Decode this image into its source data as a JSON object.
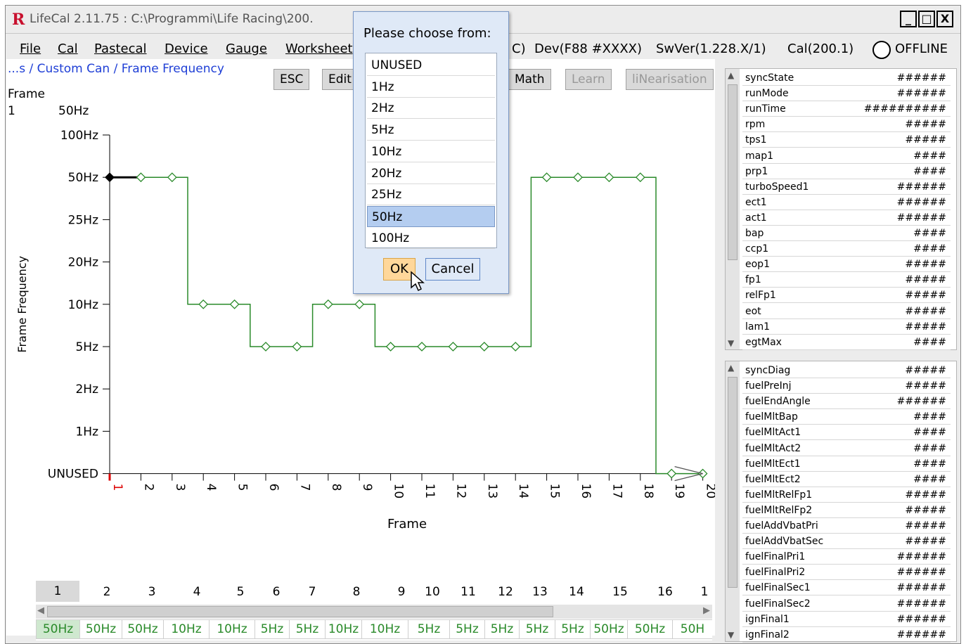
{
  "window": {
    "title": "LifeCal 2.11.75  :  C:\\Programmi\\Life Racing\\200.",
    "controls": [
      "_",
      "□",
      "X"
    ]
  },
  "menu": {
    "items": [
      "File",
      "Cal",
      "Pastecal",
      "Device",
      "Gauge",
      "Worksheet"
    ],
    "status": [
      "C)",
      "Dev(F88 #XXXX)",
      "SwVer(1.228.X/1)",
      "Cal(200.1)"
    ],
    "connection": "OFFLINE"
  },
  "editor": {
    "breadcrumb": "...s / Custom Can / Frame Frequency",
    "toolbar": {
      "esc": "ESC",
      "edit": "Edit",
      "math": "Math",
      "learn": "Learn",
      "linearisation": "liNearisation"
    },
    "cursor_name": "Frame",
    "cursor_index": "1",
    "cursor_value": "50Hz"
  },
  "chart_data": {
    "type": "line",
    "xlabel": "Frame",
    "ylabel": "Frame Frequency",
    "x": [
      1,
      2,
      3,
      4,
      5,
      6,
      7,
      8,
      9,
      10,
      11,
      12,
      13,
      14,
      15,
      16,
      17,
      18,
      19,
      20
    ],
    "y_levels": [
      "UNUSED",
      "1Hz",
      "2Hz",
      "5Hz",
      "10Hz",
      "20Hz",
      "25Hz",
      "50Hz",
      "100Hz"
    ],
    "values": [
      "50Hz",
      "50Hz",
      "50Hz",
      "10Hz",
      "10Hz",
      "5Hz",
      "5Hz",
      "10Hz",
      "10Hz",
      "5Hz",
      "5Hz",
      "5Hz",
      "5Hz",
      "5Hz",
      "50Hz",
      "50Hz",
      "50Hz",
      "50Hz",
      "UNUSED",
      "UNUSED"
    ],
    "selected_x": 1,
    "color": "#2a8a2a"
  },
  "grid": {
    "indices": [
      "1",
      "2",
      "3",
      "4",
      "5",
      "6",
      "7",
      "8",
      "9",
      "10",
      "11",
      "12",
      "13",
      "14",
      "15",
      "16",
      "1"
    ],
    "values": [
      "50Hz",
      "50Hz",
      "50Hz",
      "10Hz",
      "10Hz",
      "5Hz",
      "5Hz",
      "10Hz",
      "10Hz",
      "5Hz",
      "5Hz",
      "5Hz",
      "5Hz",
      "5Hz",
      "50Hz",
      "50Hz",
      "50H"
    ]
  },
  "gauges_top": [
    {
      "name": "syncState",
      "value": "######"
    },
    {
      "name": "runMode",
      "value": "######"
    },
    {
      "name": "runTime",
      "value": "##########"
    },
    {
      "name": "rpm",
      "value": "#####"
    },
    {
      "name": "tps1",
      "value": "#####"
    },
    {
      "name": "map1",
      "value": "####"
    },
    {
      "name": "prp1",
      "value": "####"
    },
    {
      "name": "turboSpeed1",
      "value": "######"
    },
    {
      "name": "ect1",
      "value": "######"
    },
    {
      "name": "act1",
      "value": "######"
    },
    {
      "name": "bap",
      "value": "####"
    },
    {
      "name": "ccp1",
      "value": "####"
    },
    {
      "name": "eop1",
      "value": "#####"
    },
    {
      "name": "fp1",
      "value": "#####"
    },
    {
      "name": "relFp1",
      "value": "#####"
    },
    {
      "name": "eot",
      "value": "#####"
    },
    {
      "name": "lam1",
      "value": "#####"
    },
    {
      "name": "egtMax",
      "value": "####"
    }
  ],
  "gauges_bottom": [
    {
      "name": "syncDiag",
      "value": "#####"
    },
    {
      "name": "fuelPreInj",
      "value": "#####"
    },
    {
      "name": "fuelEndAngle",
      "value": "######"
    },
    {
      "name": "fuelMltBap",
      "value": "####"
    },
    {
      "name": "fuelMltAct1",
      "value": "####"
    },
    {
      "name": "fuelMltAct2",
      "value": "####"
    },
    {
      "name": "fuelMltEct1",
      "value": "####"
    },
    {
      "name": "fuelMltEct2",
      "value": "####"
    },
    {
      "name": "fuelMltRelFp1",
      "value": "#####"
    },
    {
      "name": "fuelMltRelFp2",
      "value": "#####"
    },
    {
      "name": "fuelAddVbatPri",
      "value": "#####"
    },
    {
      "name": "fuelAddVbatSec",
      "value": "#####"
    },
    {
      "name": "fuelFinalPri1",
      "value": "######"
    },
    {
      "name": "fuelFinalPri2",
      "value": "######"
    },
    {
      "name": "fuelFinalSec1",
      "value": "######"
    },
    {
      "name": "fuelFinalSec2",
      "value": "######"
    },
    {
      "name": "ignFinal1",
      "value": "######"
    },
    {
      "name": "ignFinal2",
      "value": "######"
    }
  ],
  "dialog": {
    "title": "Please choose from:",
    "options": [
      "UNUSED",
      "1Hz",
      "2Hz",
      "5Hz",
      "10Hz",
      "20Hz",
      "25Hz",
      "50Hz",
      "100Hz"
    ],
    "selected": "50Hz",
    "ok": "OK",
    "cancel": "Cancel"
  }
}
